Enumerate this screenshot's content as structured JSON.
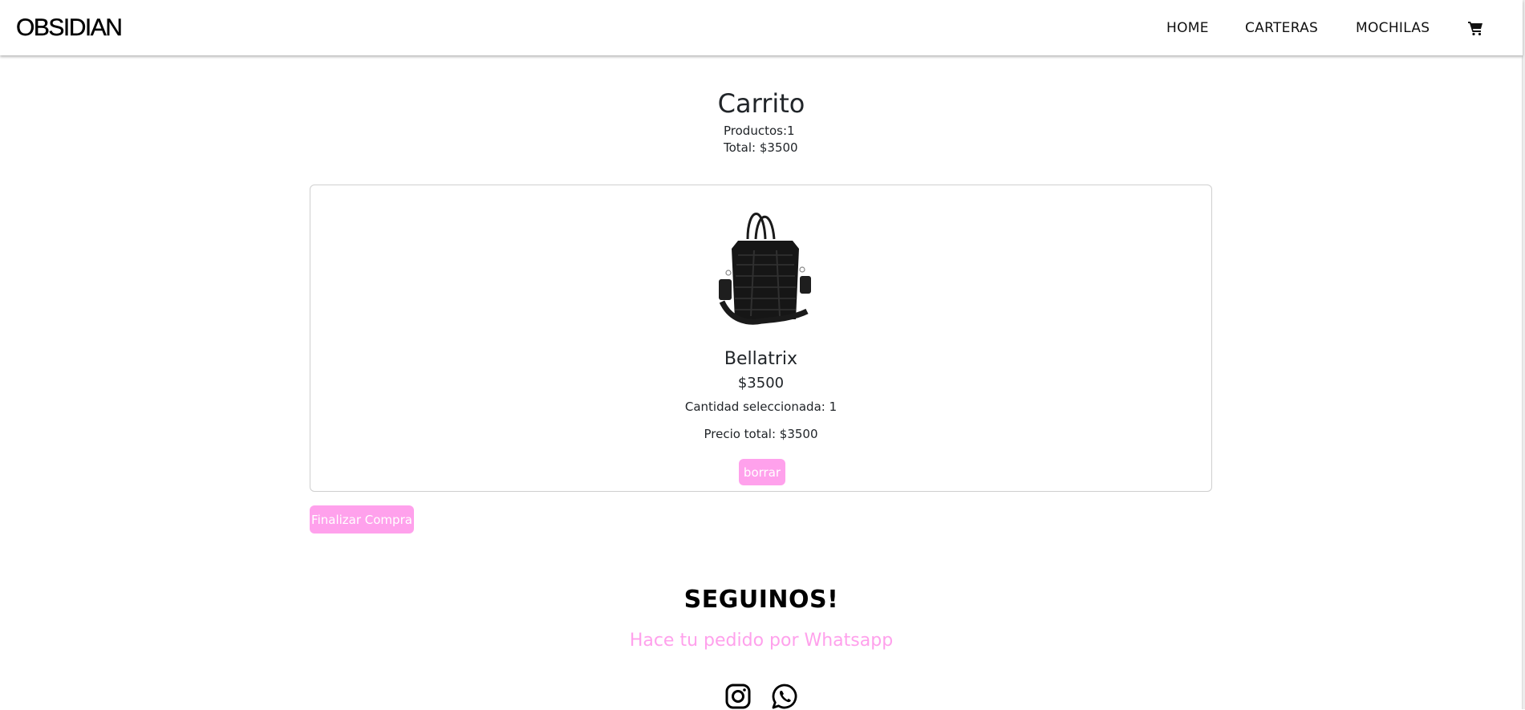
{
  "navbar": {
    "brand": "OBSIDIAN",
    "links": [
      {
        "label": "HOME"
      },
      {
        "label": "CARTERAS"
      },
      {
        "label": "MOCHILAS"
      }
    ],
    "cart_icon": "shopping-cart-icon"
  },
  "cart": {
    "title": "Carrito",
    "products_count": "Productos:1",
    "total": "Total: $3500"
  },
  "items": [
    {
      "image": "black-handbag-image",
      "name": "Bellatrix",
      "price": "$3500",
      "quantity": "Cantidad seleccionada: 1",
      "line_total": "Precio total: $3500",
      "delete_label": "borrar"
    }
  ],
  "checkout_label": "Finalizar Compra",
  "footer": {
    "heading": "SEGUINOS!",
    "whatsapp_text": "Hace tu pedido por Whatsapp",
    "social_icons": [
      "instagram-icon",
      "whatsapp-icon"
    ]
  },
  "colors": {
    "accent_pink": "#ffa1ec",
    "text": "#212529",
    "card_border": "#cfcfcf"
  }
}
